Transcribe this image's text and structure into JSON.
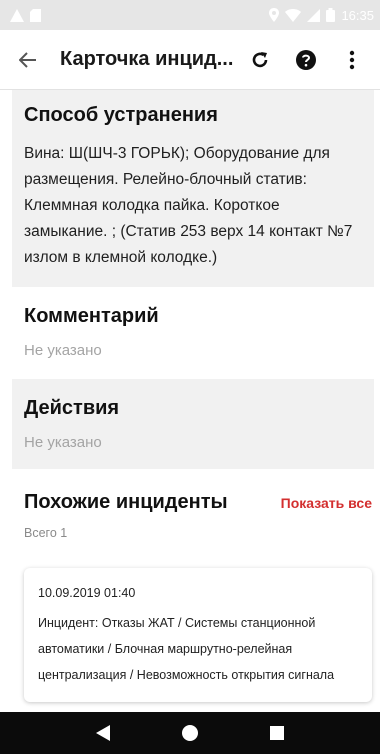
{
  "status_bar": {
    "time": "16:35",
    "icons": [
      "warning-icon",
      "sd-card-icon",
      "location-icon",
      "wifi-icon",
      "signal-icon",
      "battery-icon"
    ]
  },
  "app_bar": {
    "title": "Карточка инцид...",
    "icons": [
      "back-arrow-icon",
      "refresh-icon",
      "help-icon",
      "more-vert-icon"
    ]
  },
  "resolution": {
    "title": "Способ устранения",
    "text": "Вина: Ш(ШЧ-3 ГОРЬК); Оборудование для размещения. Релейно-блочный статив: Клеммная колодка пайка. Короткое замыкание. ; (Статив 253 верх 14 контакт №7 излом в клемной колодке.)"
  },
  "comment": {
    "title": "Комментарий",
    "value": "Не указано"
  },
  "actions": {
    "title": "Действия",
    "value": "Не указано"
  },
  "similar": {
    "title": "Похожие инциденты",
    "show_all": "Показать все",
    "total": "Всего 1",
    "cards": [
      {
        "date": "10.09.2019 01:40",
        "text": "Инцидент: Отказы ЖАТ / Системы станционной автоматики / Блочная маршрутно-релейная централизация / Невозможность открытия сигнала"
      }
    ]
  },
  "colors": {
    "accent_red": "#d32f2f",
    "section_grey": "#f1f1f1",
    "status_bar": "#e6e6e6",
    "nav_bar": "#0b0b0b"
  }
}
